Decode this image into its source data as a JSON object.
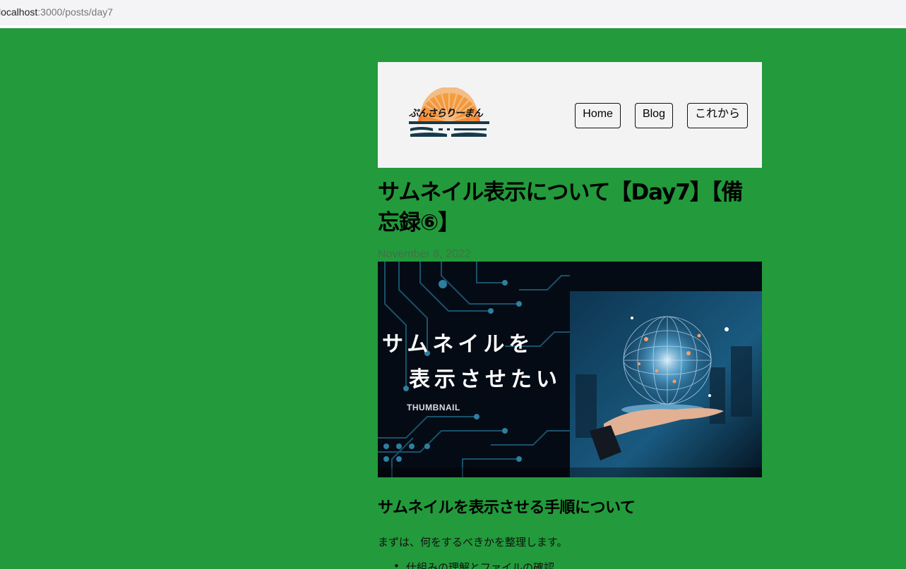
{
  "browser": {
    "url_host": "localhost",
    "url_path": ":3000/posts/day7"
  },
  "header": {
    "logo_text": "ぷんさらりーまん",
    "nav": [
      {
        "label": "Home"
      },
      {
        "label": "Blog"
      },
      {
        "label": "これから"
      }
    ]
  },
  "post": {
    "title": "サムネイル表示について【Day7】【備忘録⑥】",
    "date": "November 8, 2022",
    "thumbnail": {
      "line1": "サムネイルを",
      "line2": "表示させたい",
      "label": "THUMBNAIL"
    },
    "section_heading": "サムネイルを表示させる手順について",
    "paragraph": "まずは、何をするべきかを整理します。",
    "list": [
      "仕組みの理解とファイルの確認"
    ]
  },
  "colors": {
    "background": "#239a3b",
    "header_bg": "#f3f3f4",
    "logo_sun": "#f08a2c"
  }
}
